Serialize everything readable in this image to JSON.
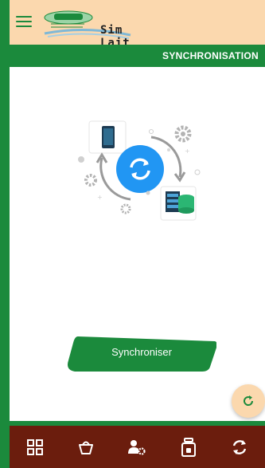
{
  "app": {
    "title": "Sim Lait"
  },
  "header": {
    "page_title": "SYNCHRONISATION"
  },
  "main": {
    "sync_button_label": "Synchroniser"
  },
  "icons": {
    "menu": "menu-icon",
    "phone": "phone-icon",
    "sync": "sync-icon",
    "database": "database-icon",
    "gear": "gear-icon",
    "refresh": "refresh-icon",
    "dashboard": "dashboard-icon",
    "basket": "basket-icon",
    "user_settings": "user-settings-icon",
    "milk_can": "milk-can-icon",
    "nav_sync": "sync-arrows-icon"
  },
  "colors": {
    "primary_green": "#1b8a3c",
    "header_peach": "#fbd8ae",
    "nav_brown": "#6b1d0d",
    "sync_blue": "#2196f3"
  }
}
